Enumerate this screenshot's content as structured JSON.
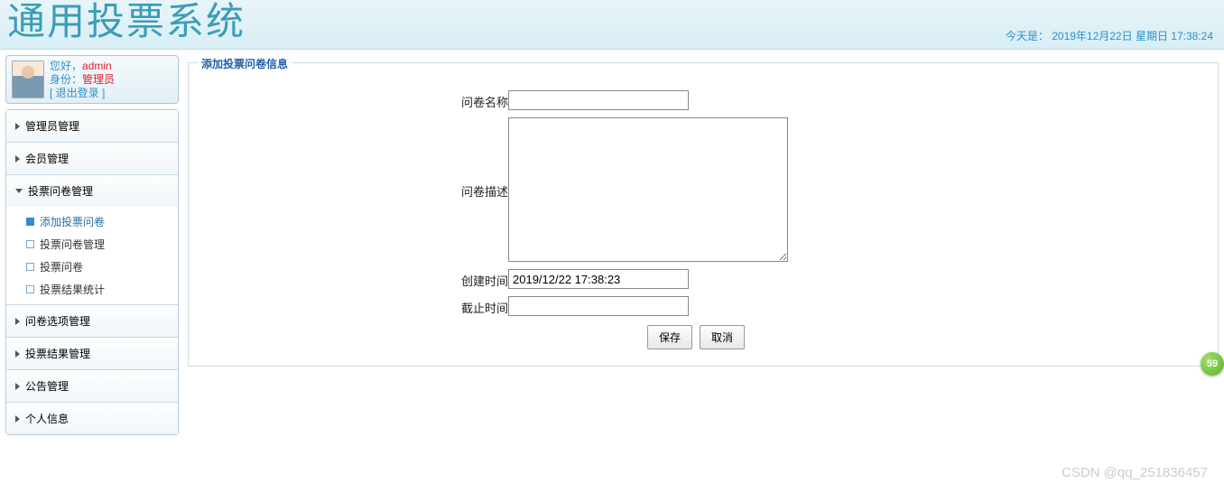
{
  "header": {
    "title": "通用投票系统",
    "date_prefix": "今天是：",
    "date_value": "2019年12月22日  星期日  17:38:24"
  },
  "user": {
    "greeting": "您好，",
    "name": "admin",
    "role_label": "身份：",
    "role_value": "管理员",
    "logout": "[ 退出登录 ]"
  },
  "nav": {
    "groups": [
      {
        "label": "管理员管理",
        "expanded": false
      },
      {
        "label": "会员管理",
        "expanded": false
      },
      {
        "label": "投票问卷管理",
        "expanded": true,
        "items": [
          {
            "label": "添加投票问卷",
            "active": true
          },
          {
            "label": "投票问卷管理",
            "active": false
          },
          {
            "label": "投票问卷",
            "active": false
          },
          {
            "label": "投票结果统计",
            "active": false
          }
        ]
      },
      {
        "label": "问卷选项管理",
        "expanded": false
      },
      {
        "label": "投票结果管理",
        "expanded": false
      },
      {
        "label": "公告管理",
        "expanded": false
      },
      {
        "label": "个人信息",
        "expanded": false
      }
    ]
  },
  "form": {
    "legend": "添加投票问卷信息",
    "name_label": "问卷名称",
    "desc_label": "问卷描述",
    "create_label": "创建时间",
    "create_value": "2019/12/22 17:38:23",
    "deadline_label": "截止时间",
    "deadline_value": "",
    "save_btn": "保存",
    "cancel_btn": "取消"
  },
  "badge": "59",
  "watermark": "CSDN @qq_251836457"
}
